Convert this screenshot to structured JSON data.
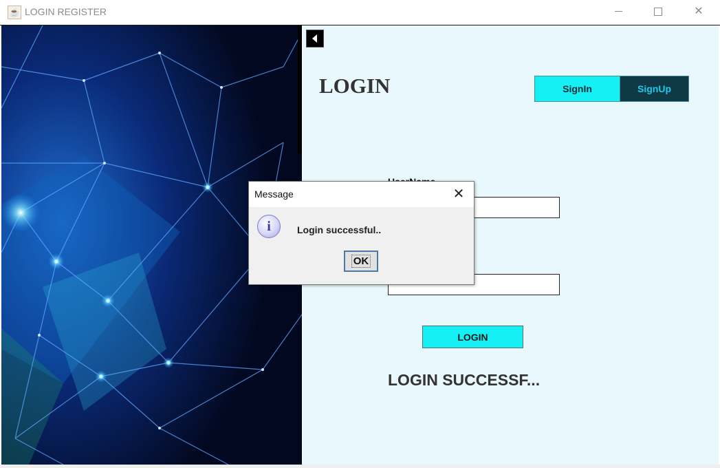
{
  "window": {
    "title": "LOGIN REGISTER",
    "icon": "java-coffee-icon",
    "controls": {
      "minimize": "minimize-icon",
      "maximize": "maximize-icon",
      "close": "close-icon"
    }
  },
  "left_panel": {
    "image": "network-abstract-background"
  },
  "right_panel": {
    "back_icon": "back-arrow-icon",
    "heading": "LOGIN",
    "tabs": [
      {
        "label": "SignIn",
        "active": true
      },
      {
        "label": "SignUp",
        "active": false
      }
    ],
    "username_label": "UserName",
    "username_value": "",
    "password_value": "",
    "login_button": "LOGIN",
    "status": "LOGIN SUCCESSF..."
  },
  "dialog": {
    "title": "Message",
    "icon": "info-icon",
    "message": "Login successful..",
    "ok_label": "OK"
  },
  "colors": {
    "accent_cyan": "#15f0f4",
    "signup_bg": "#0f3a45",
    "panel_bg": "#e8f8fc"
  }
}
